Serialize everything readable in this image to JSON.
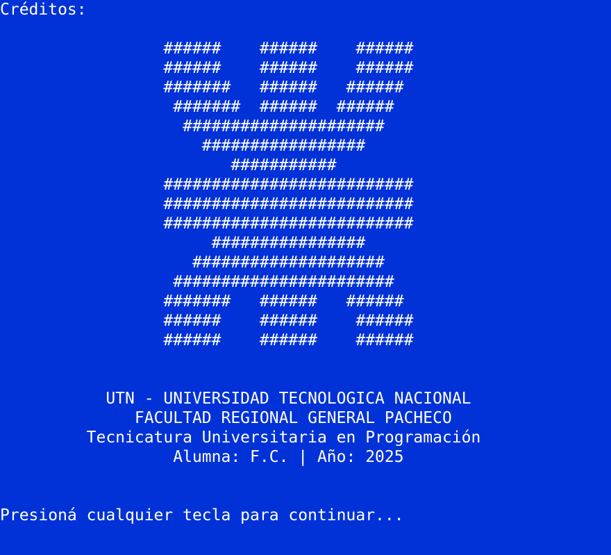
{
  "console": {
    "background_color": "#0032d7",
    "text_color": "#ffffff",
    "header": "Créditos:",
    "ascii_art": [
      "                 ######    ######    ######",
      "                 ######    ######    ######",
      "                 #######   ######   ######",
      "                  #######  ######  ######",
      "                   #####################",
      "                     #################",
      "                        ###########",
      "                 ##########################",
      "                 ##########################",
      "                 ##########################",
      "                      ################",
      "                    ####################",
      "                  #######################",
      "                 #######   ######   ######",
      "                 ######    ######    ######",
      "                 ######    ######    ######"
    ],
    "info_lines": [
      "           UTN - UNIVERSIDAD TECNOLOGICA NACIONAL",
      "              FACULTAD REGIONAL GENERAL PACHECO",
      "         Tecnicatura Universitaria en Programación",
      "                  Alumna: F.C. | Año: 2025"
    ],
    "prompt": "Presioná cualquier tecla para continuar..."
  }
}
